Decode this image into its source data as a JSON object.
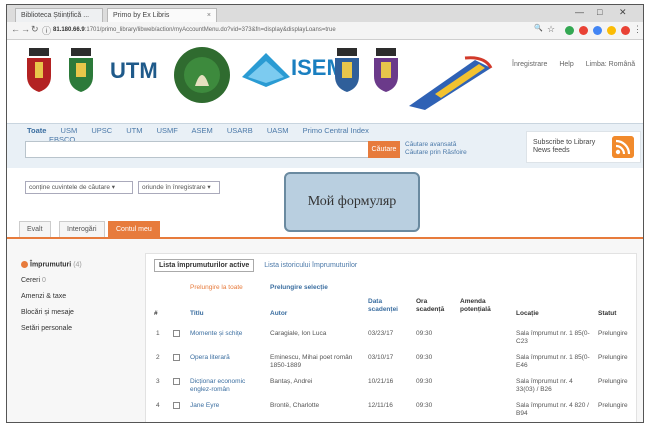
{
  "browser": {
    "tabs": [
      {
        "label": "Biblioteca Științifică ..."
      },
      {
        "label": "Primo by Ex Libris"
      }
    ],
    "url_host": "81.180.66.9",
    "url_path": ":1701/primo_library/libweb/action/myAccountMenu.do?vid=373&fn=display&displayLoans=true",
    "window_controls": {
      "minimize": "—",
      "maximize": "□",
      "close": "✕"
    }
  },
  "header": {
    "logos": [
      "UTM",
      "ISEM"
    ],
    "links": {
      "signout": "Înregistrare",
      "help": "Help",
      "language": "Limba: Română"
    }
  },
  "search": {
    "tabs": [
      "Toate",
      "USM",
      "UPSC",
      "UTM",
      "USMF",
      "ASEM",
      "USARB",
      "UASM",
      "Primo Central Index",
      "EBSCO"
    ],
    "active_tab": "Toate",
    "button": "Căutare",
    "help_links": [
      "Căutare avansată",
      "Căutare prin Răsfoire"
    ],
    "subscribe_text": "Subscribe to Library News feeds"
  },
  "filters": {
    "field_select": "conține cuvintele de căutare",
    "scope_select": "oriunde în înregistrare"
  },
  "overlay_label": "Мой формуляр",
  "main_tabs": [
    "Evalt",
    "Interogări",
    "Contul meu"
  ],
  "active_main_tab": "Contul meu",
  "sidebar": {
    "items": [
      {
        "label": "Împrumuturi",
        "count": "(4)"
      },
      {
        "label": "Cereri",
        "count": "0"
      },
      {
        "label": "Amenzi & taxe",
        "count": ""
      },
      {
        "label": "Blocări și mesaje",
        "count": ""
      },
      {
        "label": "Setări personale",
        "count": ""
      }
    ]
  },
  "loans": {
    "tab_active": "Lista împrumuturilor active",
    "tab_history": "Lista istoricului împrumuturilor",
    "extend_all": "Prelungire la toate",
    "extend_selected": "Prelungire selecție",
    "columns": [
      "#",
      "Titlu",
      "Autor",
      "Data scadenței",
      "Ora scadență",
      "Amenda potențială",
      "Locație",
      "Statut"
    ],
    "rows": [
      {
        "n": "1",
        "title": "Momente și schițe",
        "author": "Caragiale, Ion Luca",
        "due_date": "03/23/17",
        "due_time": "09:30",
        "fine": "",
        "location": "Sala împrumut nr. 1 85(0-C23",
        "status": "Prelungire"
      },
      {
        "n": "2",
        "title": "Opera literară",
        "author": "Eminescu, Mihai poet român 1850-1889",
        "due_date": "03/10/17",
        "due_time": "09:30",
        "fine": "",
        "location": "Sala împrumut nr. 1 85(0-E46",
        "status": "Prelungire"
      },
      {
        "n": "3",
        "title": "Dicționar economic englez-român",
        "author": "Bantaș, Andrei",
        "due_date": "10/21/16",
        "due_time": "09:30",
        "fine": "",
        "location": "Sala împrumut nr. 4 33(03) / B26",
        "status": "Prelungire"
      },
      {
        "n": "4",
        "title": "Jane Eyre",
        "author": "Brontë, Charlotte",
        "due_date": "12/11/16",
        "due_time": "09:30",
        "fine": "",
        "location": "Sala împrumut nr. 4 820 / B94",
        "status": "Prelungire"
      }
    ]
  },
  "colors": {
    "accent": "#e77b3c",
    "link": "#3b6ea0",
    "overlay": "#b9cfe0"
  }
}
